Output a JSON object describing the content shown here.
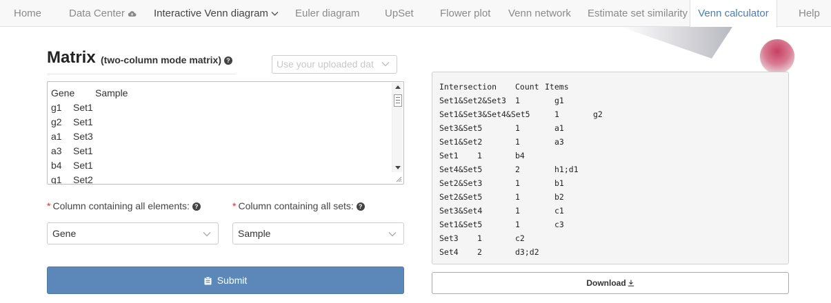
{
  "nav": {
    "items": [
      "Home",
      "Data Center",
      "Interactive Venn diagram",
      "Euler diagram",
      "UpSet",
      "Flower plot",
      "Venn network",
      "Estimate set similarity",
      "Venn calculator",
      "Help"
    ],
    "active": "Venn calculator"
  },
  "matrix": {
    "title": "Matrix",
    "subtitle": "(two-column mode matrix)",
    "data_select_placeholder": "Use your uploaded dat",
    "header": [
      "Gene",
      "Sample"
    ],
    "rows": [
      [
        "g1",
        "Set1"
      ],
      [
        "g2",
        "Set1"
      ],
      [
        "a1",
        "Set3"
      ],
      [
        "a3",
        "Set1"
      ],
      [
        "b4",
        "Set1"
      ],
      [
        "g1",
        "Set2"
      ]
    ]
  },
  "fields": {
    "elements_label": "Column containing all elements:",
    "elements_value": "Gene",
    "sets_label": "Column containing all sets:",
    "sets_value": "Sample",
    "required_mark": "*"
  },
  "submit_label": "Submit",
  "result": {
    "header": [
      "Intersection",
      "Count",
      "Items"
    ],
    "rows": [
      [
        "Set1&Set2&Set3",
        "1",
        "g1"
      ],
      [
        "Set1&Set3&Set4&Set5",
        "1",
        "g2"
      ],
      [
        "Set3&Set5",
        "1",
        "a1"
      ],
      [
        "Set1&Set2",
        "1",
        "a3"
      ],
      [
        "Set1",
        "1",
        "b4"
      ],
      [
        "Set4&Set5",
        "2",
        "h1;d1"
      ],
      [
        "Set2&Set3",
        "1",
        "b1"
      ],
      [
        "Set2&Set5",
        "1",
        "b2"
      ],
      [
        "Set3&Set4",
        "1",
        "c1"
      ],
      [
        "Set1&Set5",
        "1",
        "c3"
      ],
      [
        "Set3",
        "1",
        "c2"
      ],
      [
        "Set4",
        "2",
        "d3;d2"
      ]
    ]
  },
  "download_label": "Download",
  "colors": {
    "primary": "#5b88b8",
    "active_tab": "#4a7eb5",
    "required": "#dd3333"
  },
  "icons": {
    "data_center": "cloud-upload-icon",
    "submit": "clipboard-icon",
    "download": "download-icon",
    "help": "question-circle-icon"
  }
}
